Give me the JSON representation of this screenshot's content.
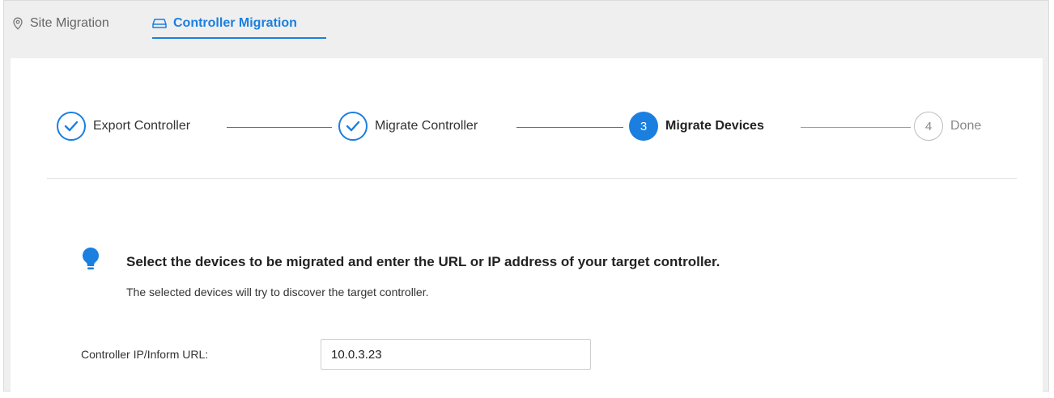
{
  "tabs": {
    "site_migration": {
      "label": "Site Migration",
      "icon": "location-pin-icon"
    },
    "controller_migration": {
      "label": "Controller Migration",
      "icon": "router-icon",
      "active": true
    }
  },
  "steps": [
    {
      "number": "1",
      "label": "Export Controller",
      "state": "done"
    },
    {
      "number": "2",
      "label": "Migrate Controller",
      "state": "done"
    },
    {
      "number": "3",
      "label": "Migrate Devices",
      "state": "active"
    },
    {
      "number": "4",
      "label": "Done",
      "state": "pending"
    }
  ],
  "tip": {
    "icon": "lightbulb-icon",
    "heading": "Select the devices to be migrated and enter the URL or IP address of your target controller.",
    "subtext": "The selected devices will try to discover the target controller."
  },
  "controller_field": {
    "label": "Controller IP/Inform URL:",
    "value": "10.0.3.23"
  },
  "colors": {
    "accent": "#1b7fe0",
    "pending": "#9e9e9e",
    "background": "#efefef"
  }
}
